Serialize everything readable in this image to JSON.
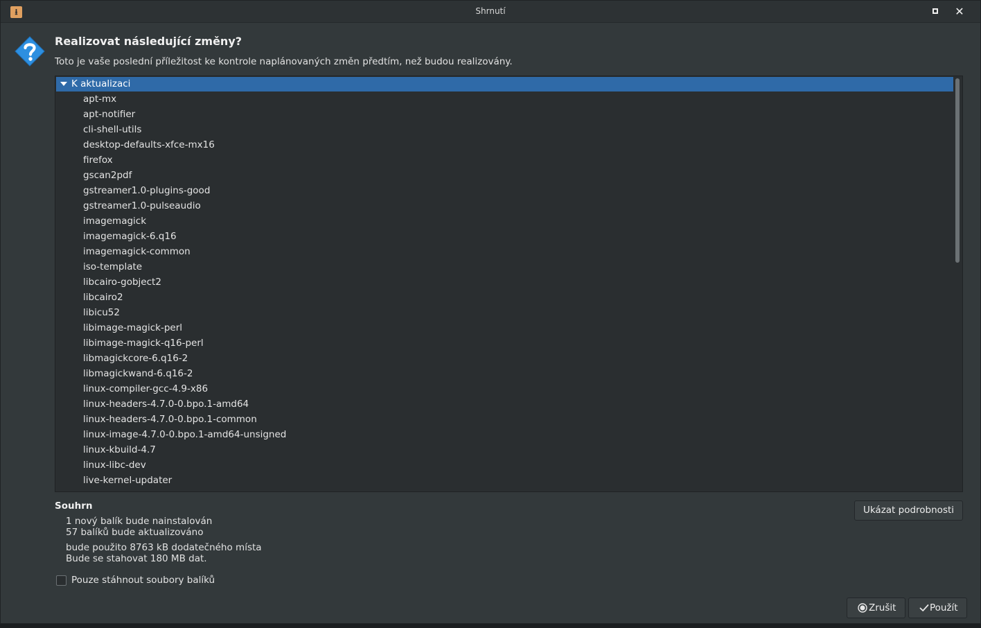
{
  "window": {
    "title": "Shrnutí",
    "app_icon_glyph": "⭳",
    "close_glyph": "✕"
  },
  "dialog": {
    "heading": "Realizovat následující změny?",
    "subheading": "Toto je vaše poslední příležitost ke kontrole naplánovaných změn předtím, než budou realizovány."
  },
  "tree": {
    "group_label": "K aktualizaci",
    "items": [
      "apt-mx",
      "apt-notifier",
      "cli-shell-utils",
      "desktop-defaults-xfce-mx16",
      "firefox",
      "gscan2pdf",
      "gstreamer1.0-plugins-good",
      "gstreamer1.0-pulseaudio",
      "imagemagick",
      "imagemagick-6.q16",
      "imagemagick-common",
      "iso-template",
      "libcairo-gobject2",
      "libcairo2",
      "libicu52",
      "libimage-magick-perl",
      "libimage-magick-q16-perl",
      "libmagickcore-6.q16-2",
      "libmagickwand-6.q16-2",
      "linux-compiler-gcc-4.9-x86",
      "linux-headers-4.7.0-0.bpo.1-amd64",
      "linux-headers-4.7.0-0.bpo.1-common",
      "linux-image-4.7.0-0.bpo.1-amd64-unsigned",
      "linux-kbuild-4.7",
      "linux-libc-dev",
      "live-kernel-updater"
    ]
  },
  "summary": {
    "label": "Souhrn",
    "line1": "1 nový balík bude nainstalován",
    "line2": "57 balíků bude aktualizováno",
    "line3": "bude použito 8763 kB dodatečného místa",
    "line4": "Bude se stahovat 180 MB dat.",
    "details_button": "Ukázat podrobnosti"
  },
  "download_only": {
    "label": "Pouze stáhnout soubory balíků",
    "checked": false
  },
  "buttons": {
    "cancel": "Zrušit",
    "apply": "Použít"
  },
  "colors": {
    "selection": "#2f6aa8",
    "background": "#33393b",
    "question_icon": "#2d8fe0"
  },
  "icons": {
    "dialog": "question-icon",
    "cancel": "cancel-circle-icon",
    "apply": "checkmark-icon",
    "expander": "triangle-down-icon"
  }
}
